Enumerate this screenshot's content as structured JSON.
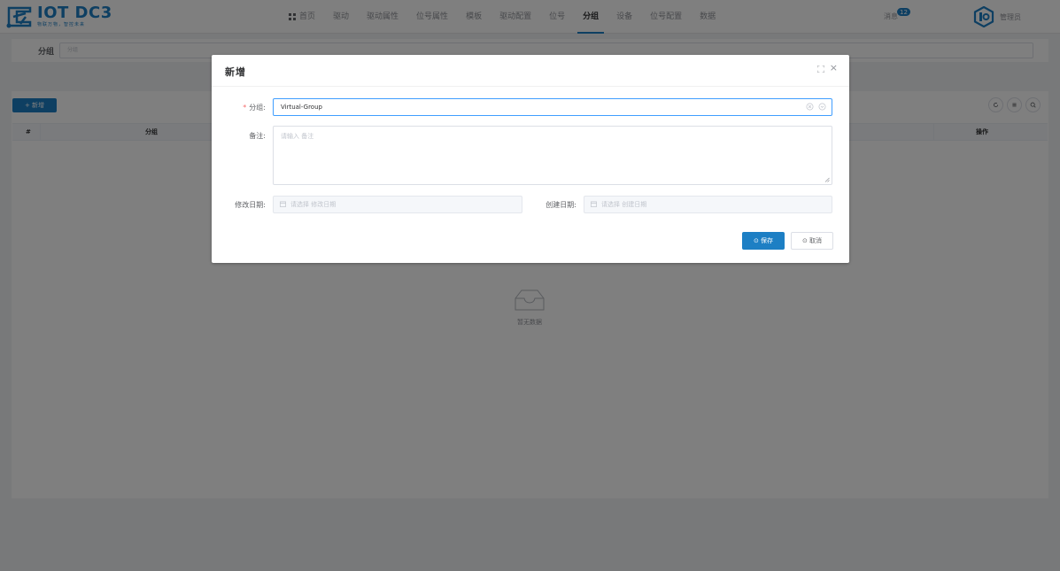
{
  "header": {
    "logo_title": "IOT DC3",
    "logo_slogan": "物联万物，智控未来",
    "nav": [
      "首页",
      "驱动",
      "驱动属性",
      "位号属性",
      "模板",
      "驱动配置",
      "位号",
      "分组",
      "设备",
      "位号配置",
      "数据"
    ],
    "active_nav": "分组",
    "notice_label": "消息",
    "notice_count": "12",
    "user_name": "管理员"
  },
  "search": {
    "label": "分组",
    "placeholder": "分组"
  },
  "table": {
    "add_button": "+ 新增",
    "columns": [
      "#",
      "分组",
      "操作"
    ],
    "empty_text": "暂无数据"
  },
  "dialog": {
    "title": "新增",
    "group_label": "分组:",
    "group_value": "Virtual-Group",
    "remark_label": "备注:",
    "remark_placeholder": "请输入 备注",
    "update_date_label": "修改日期:",
    "update_date_placeholder": "请选择 修改日期",
    "create_date_label": "创建日期:",
    "create_date_placeholder": "请选择 创建日期",
    "save_button": "⊙ 保存",
    "cancel_button": "⊙ 取消"
  },
  "colors": {
    "primary": "#1d7fc4",
    "required": "#f56c6c",
    "focus_border": "#409eff"
  }
}
